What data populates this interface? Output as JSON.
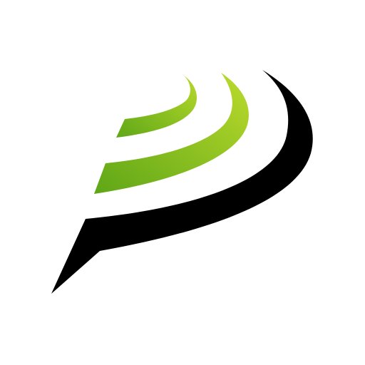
{
  "logo": {
    "name": "speech-bubble-signal-logo",
    "background_color": "#ffffff",
    "colors": {
      "bubble": "#000000",
      "arc_light": "#a8d023",
      "arc_mid": "#8cc21d",
      "arc_dark": "#5fa718"
    }
  }
}
